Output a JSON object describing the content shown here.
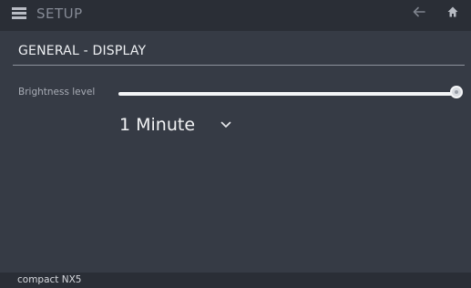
{
  "header": {
    "title": "SETUP",
    "menu_icon": "menu-icon",
    "back_icon": "arrow-left-icon",
    "home_icon": "home-icon"
  },
  "section": {
    "title": "GENERAL - DISPLAY"
  },
  "brightness": {
    "label": "Brightness level",
    "value_fraction": 1.0
  },
  "timeout": {
    "selected": "1 Minute"
  },
  "footer": {
    "device_name": "compact NX5"
  },
  "colors": {
    "background": "#363b45",
    "bar": "#2a2e36",
    "text": "#eef0f3",
    "muted": "#868b96",
    "slider_fill": "#f4f5f7"
  }
}
